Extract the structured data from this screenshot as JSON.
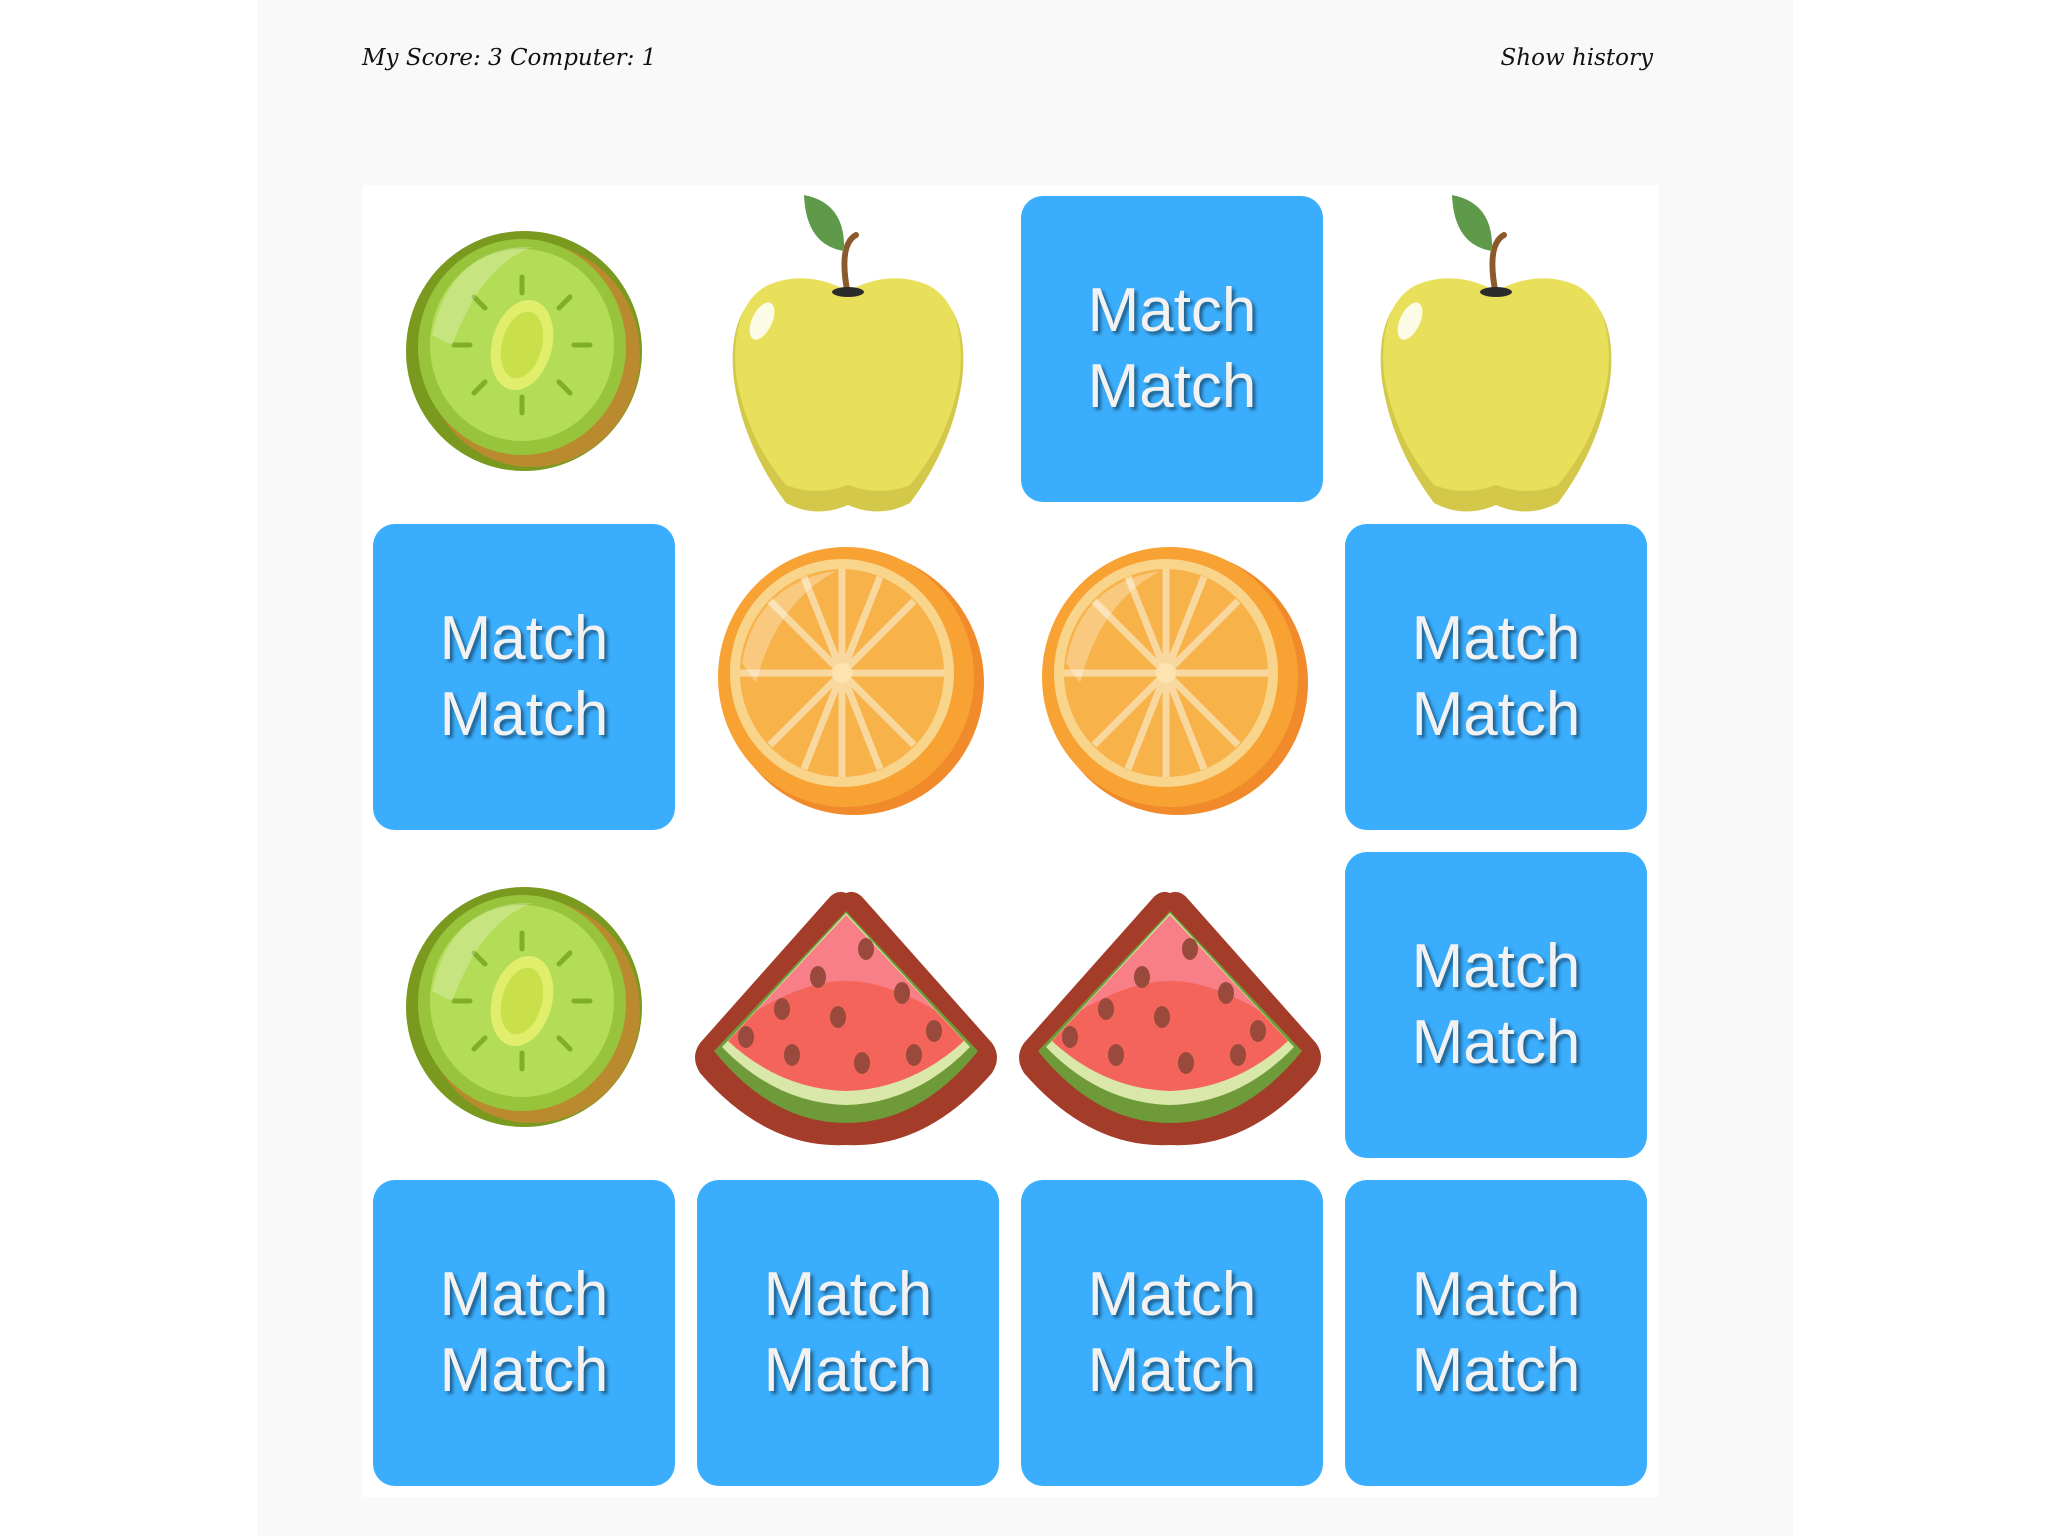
{
  "header": {
    "score_text": "My Score: 3 Computer: 1",
    "show_history_label": "Show history"
  },
  "card_back": {
    "line1": "Match",
    "line2": "Match",
    "color": "#3aadfd"
  },
  "board": {
    "columns": 4,
    "rows": 4,
    "cards": [
      {
        "state": "face-up",
        "fruit": "kiwi"
      },
      {
        "state": "face-up",
        "fruit": "apple"
      },
      {
        "state": "face-down",
        "fruit": ""
      },
      {
        "state": "face-up",
        "fruit": "apple"
      },
      {
        "state": "face-down",
        "fruit": ""
      },
      {
        "state": "face-up",
        "fruit": "orange"
      },
      {
        "state": "face-up",
        "fruit": "orange"
      },
      {
        "state": "face-down",
        "fruit": ""
      },
      {
        "state": "face-up",
        "fruit": "kiwi"
      },
      {
        "state": "face-up",
        "fruit": "watermelon"
      },
      {
        "state": "face-up",
        "fruit": "watermelon"
      },
      {
        "state": "face-down",
        "fruit": ""
      },
      {
        "state": "face-down",
        "fruit": ""
      },
      {
        "state": "face-down",
        "fruit": ""
      },
      {
        "state": "face-down",
        "fruit": ""
      },
      {
        "state": "face-down",
        "fruit": ""
      }
    ]
  }
}
